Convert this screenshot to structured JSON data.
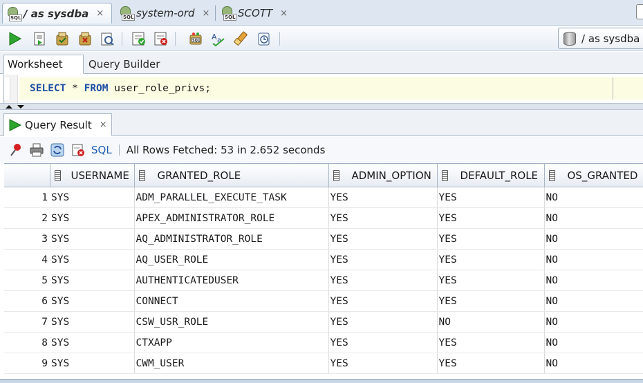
{
  "doc_tabs": [
    {
      "label": "/ as sysdba",
      "close": "×",
      "active": true
    },
    {
      "label": "system-ord",
      "close": "×",
      "active": false
    },
    {
      "label": "SCOTT",
      "close": "×",
      "active": false
    }
  ],
  "sql_icon_badge": "SQL",
  "connection": {
    "label": "/ as sysdba"
  },
  "toolbar_icons": [
    "run-statement-icon",
    "run-script-icon",
    "commit-icon",
    "rollback-icon",
    "autotrace-icon",
    "explain-plan-icon",
    "sql-tuning-icon",
    "unshared-sql-icon",
    "format-icon",
    "clear-icon",
    "history-icon"
  ],
  "worksheet_tabs": {
    "worksheet": "Worksheet",
    "query_builder": "Query Builder"
  },
  "editor": {
    "keyword1": "SELECT",
    "middle": " * ",
    "keyword2": "FROM",
    "rest": " user_role_privs;"
  },
  "result_tab": {
    "label": "Query Result",
    "close": "×"
  },
  "result_toolbar": {
    "sql_label": "SQL",
    "status": "All Rows Fetched: 53 in 2.652 seconds"
  },
  "grid": {
    "columns": [
      "USERNAME",
      "GRANTED_ROLE",
      "ADMIN_OPTION",
      "DEFAULT_ROLE",
      "OS_GRANTED"
    ],
    "rows": [
      [
        "1",
        "SYS",
        "ADM_PARALLEL_EXECUTE_TASK",
        "YES",
        "YES",
        "NO"
      ],
      [
        "2",
        "SYS",
        "APEX_ADMINISTRATOR_ROLE",
        "YES",
        "YES",
        "NO"
      ],
      [
        "3",
        "SYS",
        "AQ_ADMINISTRATOR_ROLE",
        "YES",
        "YES",
        "NO"
      ],
      [
        "4",
        "SYS",
        "AQ_USER_ROLE",
        "YES",
        "YES",
        "NO"
      ],
      [
        "5",
        "SYS",
        "AUTHENTICATEDUSER",
        "YES",
        "YES",
        "NO"
      ],
      [
        "6",
        "SYS",
        "CONNECT",
        "YES",
        "YES",
        "NO"
      ],
      [
        "7",
        "SYS",
        "CSW_USR_ROLE",
        "YES",
        "NO",
        "NO"
      ],
      [
        "8",
        "SYS",
        "CTXAPP",
        "YES",
        "YES",
        "NO"
      ],
      [
        "9",
        "SYS",
        "CWM_USER",
        "YES",
        "YES",
        "NO"
      ]
    ]
  },
  "colors": {
    "keyword": "#1f4fa5",
    "editor_bg": "#fcfce3",
    "tabbar_bg": "#dde6f1",
    "run_green": "#2ea52e"
  }
}
